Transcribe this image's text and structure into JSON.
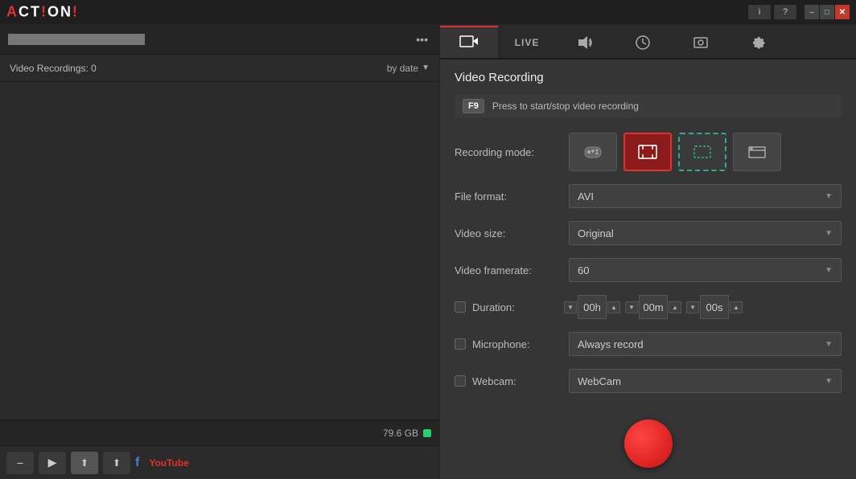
{
  "app": {
    "logo_text": "ACT!ON!",
    "logo_exclaim_color": "#e03030"
  },
  "titlebar": {
    "info_btn": "i",
    "help_btn": "?",
    "minimize_btn": "–",
    "maximize_btn": "□",
    "close_btn": "✕"
  },
  "left_panel": {
    "folder_path": "████████████████████",
    "recordings_label": "Video Recordings: 0",
    "sort_label": "by date",
    "storage_text": "79.6 GB"
  },
  "toolbar": {
    "minus_icon": "−",
    "play_icon": "▶",
    "upload_icon": "↑",
    "share_icon": "↑",
    "facebook_icon": "f",
    "youtube_label": "YouTube"
  },
  "tabs": [
    {
      "id": "video",
      "icon": "▣",
      "active": true
    },
    {
      "id": "live",
      "label": "LIVE",
      "active": false
    },
    {
      "id": "audio",
      "icon": "♪",
      "active": false
    },
    {
      "id": "gamepad",
      "icon": "⏱",
      "active": false
    },
    {
      "id": "screenshot",
      "icon": "◉",
      "active": false
    },
    {
      "id": "settings",
      "icon": "⚙",
      "active": false
    }
  ],
  "video_recording": {
    "section_title": "Video Recording",
    "shortcut_key": "F9",
    "shortcut_desc": "Press to start/stop video recording",
    "recording_mode_label": "Recording mode:",
    "modes": [
      {
        "id": "gamepad",
        "icon": "🎮",
        "active": false
      },
      {
        "id": "fullscreen",
        "icon": "⛶",
        "active": true
      },
      {
        "id": "region",
        "icon": "⬚",
        "active": false,
        "dashed": true
      },
      {
        "id": "window",
        "icon": "▬",
        "active": false
      }
    ],
    "file_format_label": "File format:",
    "file_format_value": "AVI",
    "video_size_label": "Video size:",
    "video_size_value": "Original",
    "video_framerate_label": "Video framerate:",
    "video_framerate_value": "60",
    "duration_label": "Duration:",
    "duration_hours": "00h",
    "duration_minutes": "00m",
    "duration_seconds": "00s",
    "microphone_label": "Microphone:",
    "microphone_value": "Always record",
    "webcam_label": "Webcam:",
    "webcam_value": "WebCam"
  }
}
